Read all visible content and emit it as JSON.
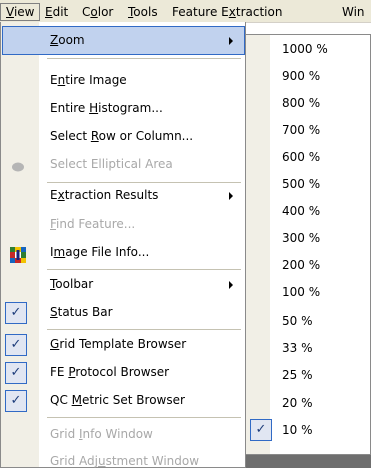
{
  "menubar": {
    "items": [
      {
        "pre": "",
        "u": "V",
        "post": "iew"
      },
      {
        "pre": "",
        "u": "E",
        "post": "dit"
      },
      {
        "pre": "C",
        "u": "o",
        "post": "lor"
      },
      {
        "pre": "",
        "u": "T",
        "post": "ools"
      },
      {
        "pre": "Feature E",
        "u": "x",
        "post": "traction"
      },
      {
        "pre": "Win",
        "u": "",
        "post": ""
      }
    ]
  },
  "view_menu": {
    "zoom": {
      "pre": "",
      "u": "Z",
      "post": "oom"
    },
    "entire_image": {
      "pre": "E",
      "u": "n",
      "post": "tire Image"
    },
    "entire_histogram": {
      "pre": "Entire ",
      "u": "H",
      "post": "istogram..."
    },
    "select_row": {
      "pre": "Select ",
      "u": "R",
      "post": "ow or Column..."
    },
    "select_elliptical": {
      "pre": "Select Elliptical Area",
      "u": "",
      "post": ""
    },
    "extraction_results": {
      "pre": "E",
      "u": "x",
      "post": "traction Results"
    },
    "find_feature": {
      "pre": "",
      "u": "F",
      "post": "ind Feature..."
    },
    "image_file_info": {
      "pre": "I",
      "u": "m",
      "post": "age File Info..."
    },
    "toolbar": {
      "pre": "",
      "u": "T",
      "post": "oolbar"
    },
    "status_bar": {
      "pre": "",
      "u": "S",
      "post": "tatus Bar"
    },
    "grid_template": {
      "pre": "",
      "u": "G",
      "post": "rid Template Browser"
    },
    "fe_protocol": {
      "pre": "FE ",
      "u": "P",
      "post": "rotocol Browser"
    },
    "qc_metric": {
      "pre": "QC ",
      "u": "M",
      "post": "etric Set Browser"
    },
    "grid_info": {
      "pre": "Grid ",
      "u": "I",
      "post": "nfo Window"
    },
    "grid_adjustment": {
      "pre": "Grid Adj",
      "u": "u",
      "post": "stment Window"
    }
  },
  "zoom_menu": {
    "options": [
      "1000 %",
      "900 %",
      "800 %",
      "700 %",
      "600 %",
      "500 %",
      "400 %",
      "300 %",
      "200 %",
      "100 %",
      "50 %",
      "33 %",
      "25 %",
      "20 %",
      "10 %"
    ],
    "checked": "10 %"
  },
  "icons": {
    "check": "✓",
    "submenu_arrow": "right-triangle",
    "ellipse": "ellipse-icon",
    "image_info": "image-info-icon"
  }
}
